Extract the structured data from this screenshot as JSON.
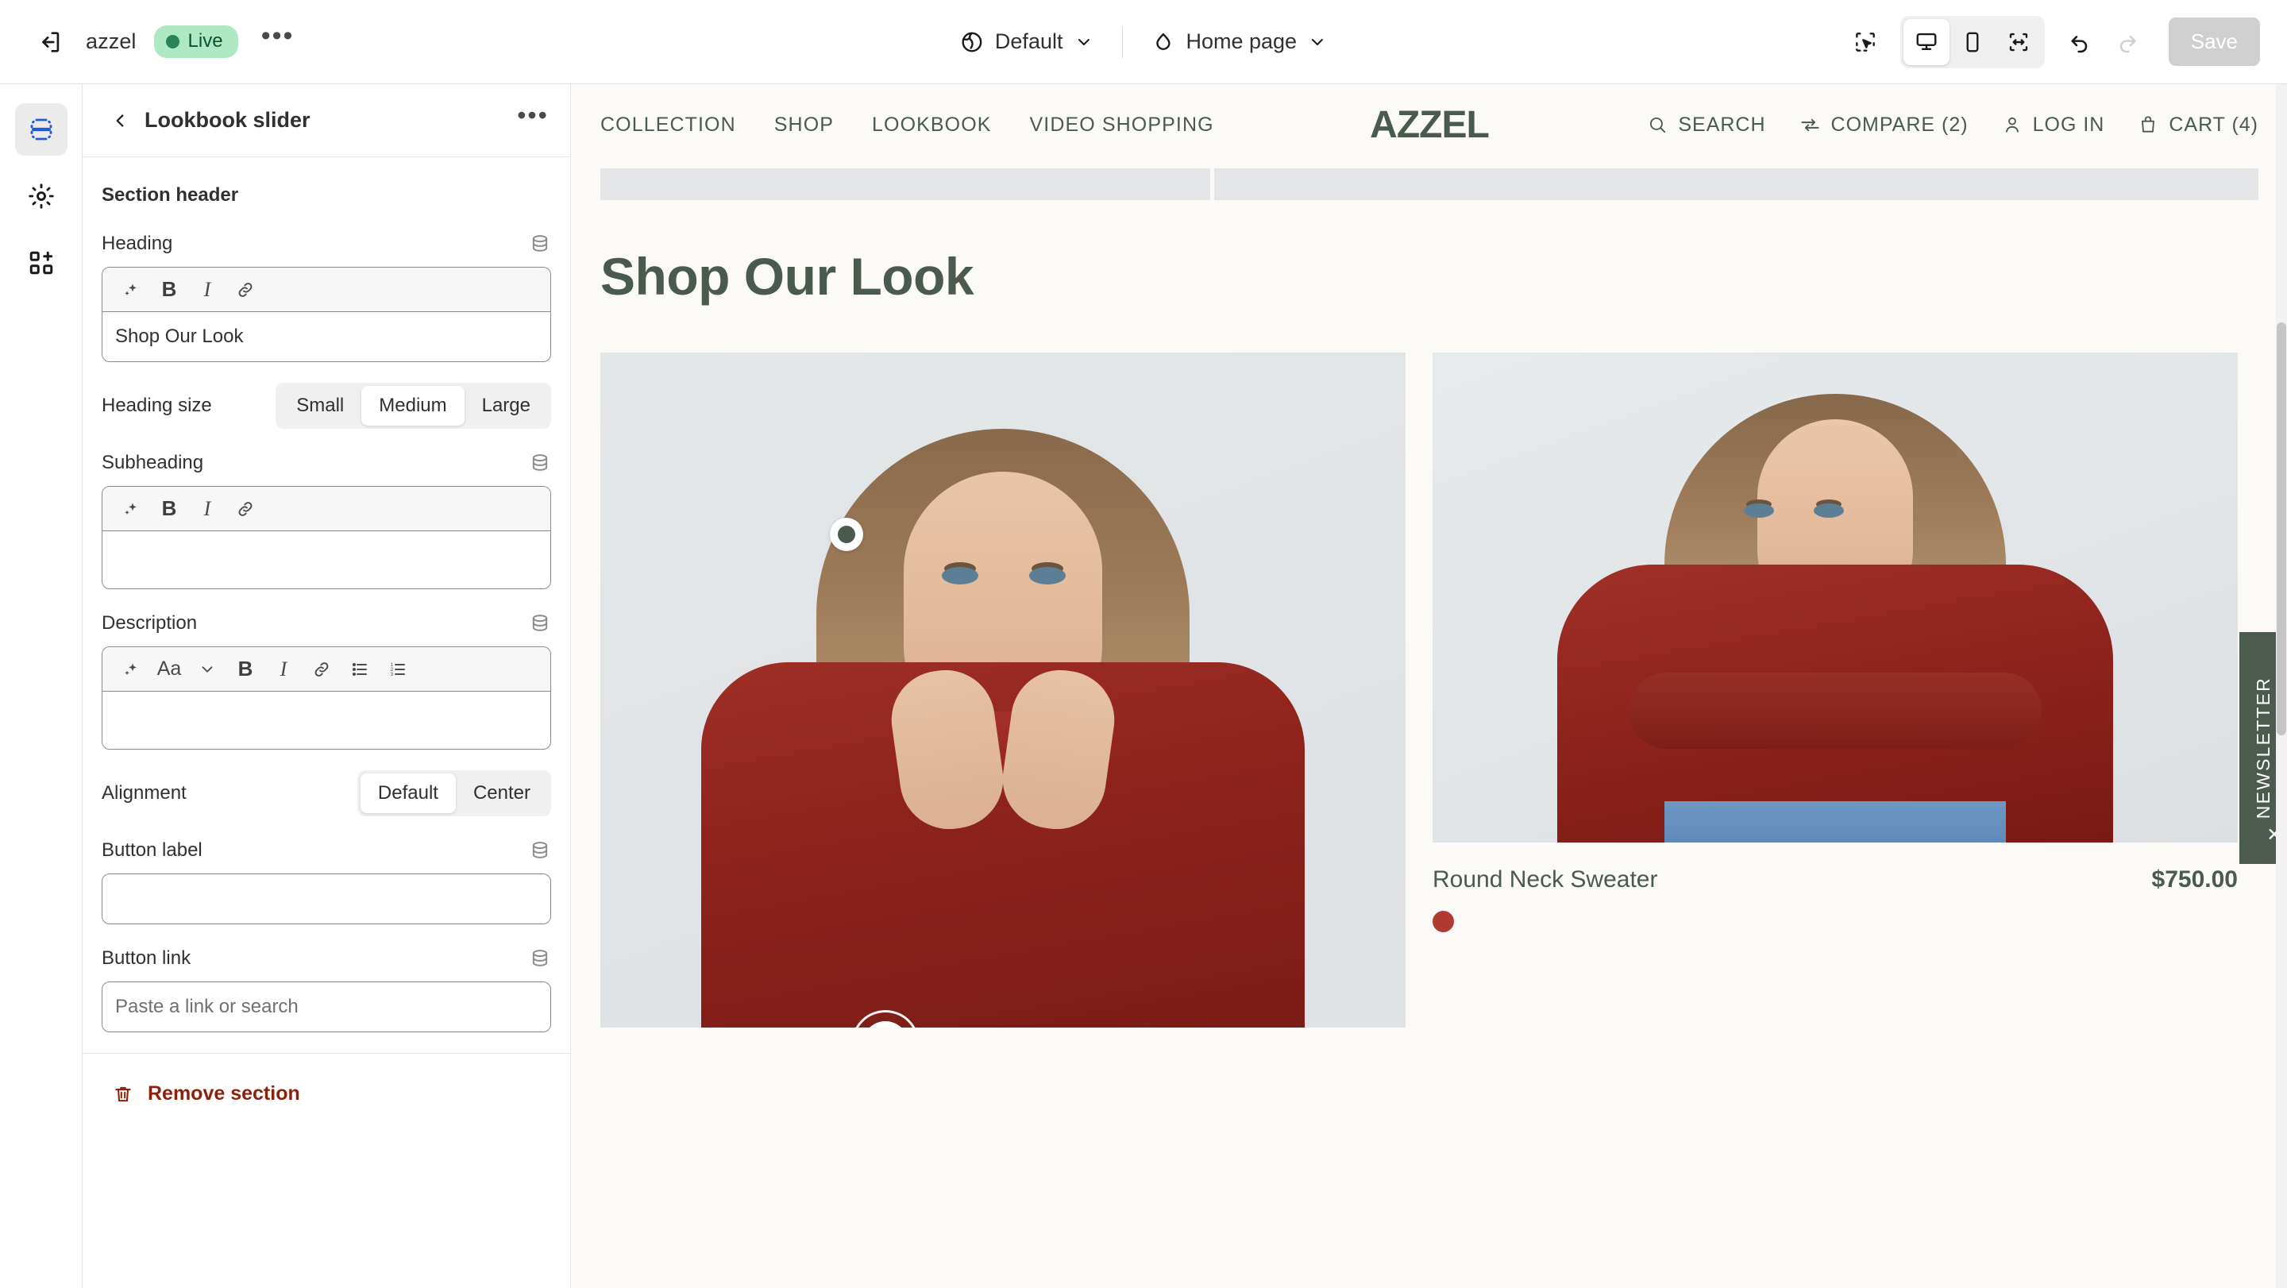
{
  "topbar": {
    "exit_icon": "exit-icon",
    "shop_name": "azzel",
    "live_label": "Live",
    "more_label": "•••",
    "context": {
      "theme_icon": "globe-icon",
      "theme_label": "Default",
      "page_icon": "home-icon",
      "page_label": "Home page"
    },
    "tools": {
      "select_icon": "pointer-select-icon",
      "desktop_icon": "desktop-icon",
      "mobile_icon": "mobile-icon",
      "fullwidth_icon": "full-width-icon",
      "undo_icon": "undo-icon",
      "redo_icon": "redo-icon",
      "save_label": "Save"
    }
  },
  "rail": {
    "items": [
      {
        "icon": "sections-icon",
        "name": "sections"
      },
      {
        "icon": "gear-icon",
        "name": "settings"
      },
      {
        "icon": "apps-add-icon",
        "name": "apps"
      }
    ]
  },
  "sidebar": {
    "back_icon": "chevron-left-icon",
    "title": "Lookbook slider",
    "more_label": "•••",
    "group_title": "Section header",
    "fields": {
      "heading": {
        "label": "Heading",
        "value": "Shop Our Look",
        "toolbar": [
          "magic-icon",
          "bold-icon",
          "italic-icon",
          "link-icon"
        ],
        "bold_label": "B",
        "italic_label": "I"
      },
      "heading_size": {
        "label": "Heading size",
        "options": [
          "Small",
          "Medium",
          "Large"
        ],
        "selected": "Medium"
      },
      "subheading": {
        "label": "Subheading",
        "value": "",
        "toolbar": [
          "magic-icon",
          "bold-icon",
          "italic-icon",
          "link-icon"
        ],
        "bold_label": "B",
        "italic_label": "I"
      },
      "description": {
        "label": "Description",
        "value": "",
        "font_label": "Aa",
        "toolbar": [
          "magic-icon",
          "font-size-icon",
          "chevron-down-icon",
          "bold-icon",
          "italic-icon",
          "link-icon",
          "bulleted-list-icon",
          "numbered-list-icon"
        ],
        "bold_label": "B",
        "italic_label": "I"
      },
      "alignment": {
        "label": "Alignment",
        "options": [
          "Default",
          "Center"
        ],
        "selected": "Default"
      },
      "button_label": {
        "label": "Button label",
        "value": "",
        "placeholder": ""
      },
      "button_link": {
        "label": "Button link",
        "value": "",
        "placeholder": "Paste a link or search"
      }
    },
    "remove": {
      "icon": "trash-icon",
      "label": "Remove section",
      "color": "#8e1f0b"
    }
  },
  "preview": {
    "store": {
      "nav": [
        "COLLECTION",
        "SHOP",
        "LOOKBOOK",
        "VIDEO SHOPPING"
      ],
      "logo": "AZZEL",
      "actions": [
        {
          "icon": "search-icon",
          "label": "SEARCH"
        },
        {
          "icon": "compare-icon",
          "label": "COMPARE (2)"
        },
        {
          "icon": "user-icon",
          "label": "LOG IN"
        },
        {
          "icon": "bag-icon",
          "label": "CART (4)"
        }
      ],
      "accent_color": "#4a5a4e",
      "background_color": "#fbfaf6"
    },
    "section": {
      "heading": "Shop Our Look",
      "hotspots": [
        {
          "name": "hotspot-upper",
          "state": "inactive"
        },
        {
          "name": "hotspot-lower",
          "state": "active"
        }
      ]
    },
    "product_card": {
      "name": "Round Neck Sweater",
      "price": "$750.00",
      "swatches": [
        "#b13a32"
      ]
    },
    "newsletter_tab": {
      "label": "NEWSLETTER",
      "close_label": "✕",
      "background_color": "#4d5a4e"
    }
  }
}
